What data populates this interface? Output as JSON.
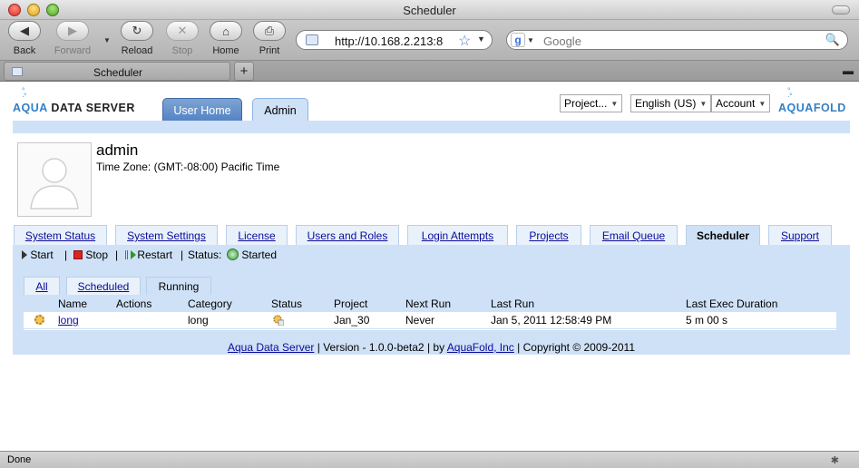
{
  "window": {
    "title": "Scheduler"
  },
  "toolbar": {
    "back": "Back",
    "forward": "Forward",
    "reload": "Reload",
    "stop": "Stop",
    "home": "Home",
    "print": "Print",
    "url": "http://10.168.2.213:8",
    "search_placeholder": "Google"
  },
  "browser_tab": {
    "label": "Scheduler",
    "new_tab": "+"
  },
  "header": {
    "logo_left": {
      "aqua": "AQUA",
      "rest": "DATA SERVER"
    },
    "logo_right": {
      "aqua": "AQUA",
      "rest": "FOLD"
    },
    "tabs": [
      {
        "label": "User Home"
      },
      {
        "label": "Admin"
      }
    ],
    "selects": [
      {
        "label": "Project..."
      },
      {
        "label": "English (US)"
      },
      {
        "label": "Account"
      }
    ]
  },
  "profile": {
    "name": "admin",
    "timezone": "Time Zone: (GMT:-08:00) Pacific Time"
  },
  "main_tabs": [
    {
      "label": "System Status"
    },
    {
      "label": "System Settings"
    },
    {
      "label": "License"
    },
    {
      "label": "Users and Roles"
    },
    {
      "label": "Login Attempts"
    },
    {
      "label": "Projects"
    },
    {
      "label": "Email Queue"
    },
    {
      "label": "Scheduler"
    },
    {
      "label": "Support"
    }
  ],
  "controls": {
    "start": "Start",
    "sep": "|",
    "stop": "Stop",
    "restart": "Restart",
    "status_label": "Status:",
    "status_value": "Started"
  },
  "sub_tabs": [
    {
      "label": "All"
    },
    {
      "label": "Scheduled"
    },
    {
      "label": "Running"
    }
  ],
  "table": {
    "columns": [
      "Name",
      "Actions",
      "Category",
      "Status",
      "Project",
      "Next Run",
      "Last Run",
      "Last Exec Duration"
    ],
    "rows": [
      {
        "name": "long",
        "actions": "",
        "category": "long",
        "project": "Jan_30",
        "next_run": "Never",
        "last_run": "Jan 5, 2011 12:58:49 PM",
        "duration": "5 m 00 s"
      }
    ]
  },
  "footer": {
    "link1": "Aqua Data Server",
    "sep1": "|",
    "version": "Version - 1.0.0-beta2",
    "sep2": "|",
    "by": "by",
    "link2": "AquaFold, Inc",
    "sep3": "|",
    "copyright": "Copyright © 2009-2011"
  },
  "statusbar": {
    "text": "Done"
  }
}
